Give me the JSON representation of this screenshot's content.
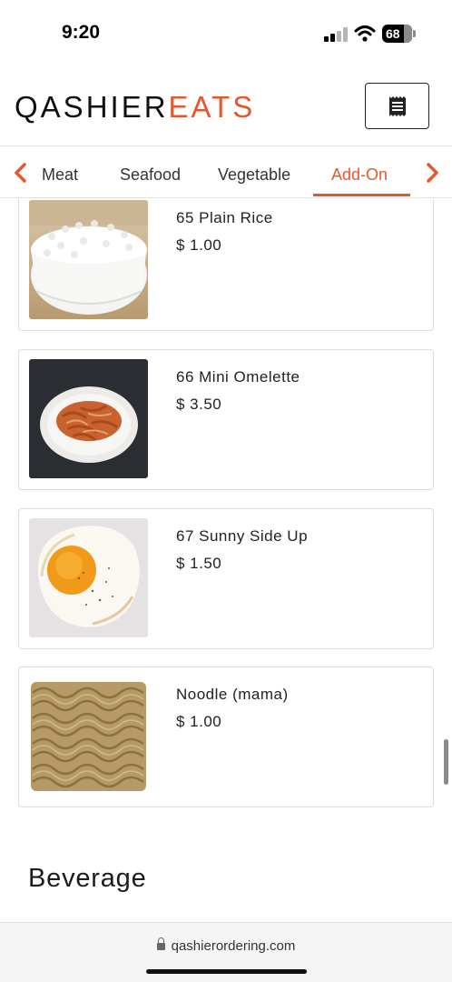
{
  "status_bar": {
    "time": "9:20",
    "battery": "68"
  },
  "header": {
    "logo_part1": "QASHIER",
    "logo_part2": "EATS",
    "brand_color": "#e4582d",
    "menu_icon": "receipt-icon"
  },
  "categories": {
    "tabs": [
      {
        "label": "Meat",
        "active": false
      },
      {
        "label": "Seafood",
        "active": false
      },
      {
        "label": "Vegetable",
        "active": false
      },
      {
        "label": "Add-On",
        "active": true
      }
    ],
    "prev_icon": "chevron-left-icon",
    "next_icon": "chevron-right-icon"
  },
  "items": [
    {
      "name": "65 Plain Rice",
      "price": "$ 1.00",
      "image": "plain-rice-photo"
    },
    {
      "name": "66 Mini Omelette",
      "price": "$ 3.50",
      "image": "mini-omelette-photo"
    },
    {
      "name": "67 Sunny Side Up",
      "price": "$ 1.50",
      "image": "sunny-side-up-photo"
    },
    {
      "name": "Noodle (mama)",
      "price": "$ 1.00",
      "image": "instant-noodle-photo"
    }
  ],
  "next_section": {
    "title": "Beverage"
  },
  "browser": {
    "url": "qashierordering.com"
  }
}
